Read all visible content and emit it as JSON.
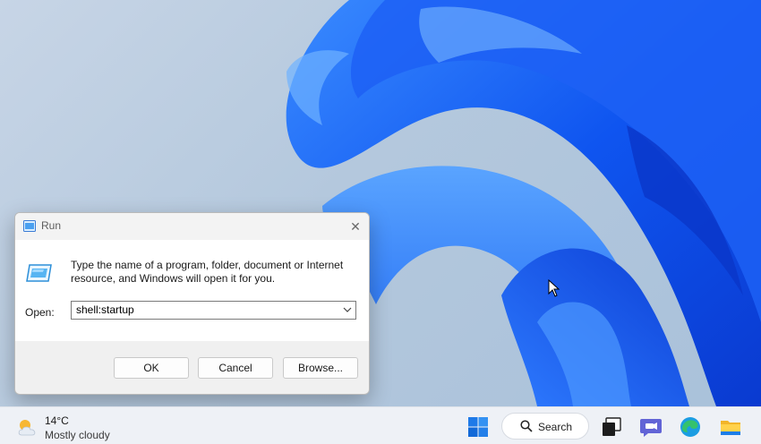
{
  "run_dialog": {
    "title": "Run",
    "close_glyph": "✕",
    "description": "Type the name of a program, folder, document or Internet resource, and Windows will open it for you.",
    "open_label": "Open:",
    "open_value": "shell:startup",
    "buttons": {
      "ok": "OK",
      "cancel": "Cancel",
      "browse": "Browse..."
    }
  },
  "taskbar": {
    "weather": {
      "temp": "14°C",
      "condition": "Mostly cloudy",
      "icon": "partly-cloudy-icon"
    },
    "search_label": "Search",
    "icons": [
      "windows-start-icon",
      "search-icon",
      "task-view-icon",
      "teams-chat-icon",
      "edge-browser-icon",
      "file-explorer-icon"
    ]
  },
  "colors": {
    "wallpaper_blue": "#1f5cf0",
    "dialog_bg": "#f0f0f0",
    "taskbar_bg": "#eef1f6"
  }
}
